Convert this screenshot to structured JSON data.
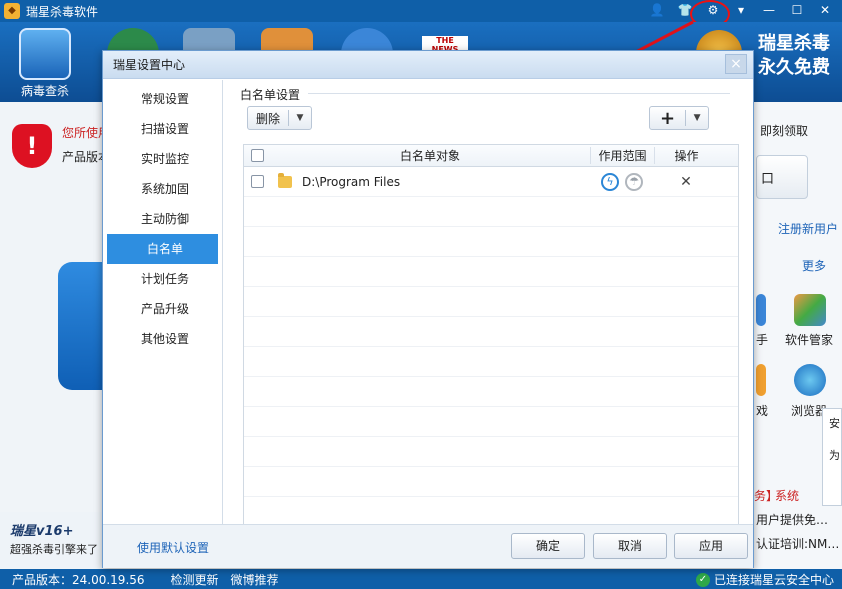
{
  "app": {
    "title": "瑞星杀毒软件",
    "nav": [
      {
        "label": "病毒查杀"
      },
      {
        "label": ""
      },
      {
        "label": ""
      },
      {
        "label": ""
      },
      {
        "label": ""
      },
      {
        "label": "THE NEWS"
      }
    ],
    "brand_line1": "瑞星杀毒",
    "brand_line2": "永久免费",
    "warn_text": "您所使用",
    "product_label": "产品版本",
    "right_links": {
      "receive": "即刻领取",
      "register": "注册新用户",
      "more": "更多",
      "tool_helper": "手",
      "software_mgr": "软件管家",
      "game": "戏",
      "browser": "浏览器",
      "system": "系统",
      "news1": "用户提供免…",
      "news2": "认证培训:NM…",
      "badge_partial": "为",
      "safe_partial": "安",
      "bracket": "务】",
      "button_partial": "口"
    },
    "promo_title": "瑞星v16+",
    "promo_sub": "超强杀毒引擎来了",
    "status": {
      "version": "产品版本：24.00.19.56",
      "check_update": "检测更新",
      "weibo": "微博推荐",
      "cloud": "已连接瑞星云安全中心"
    }
  },
  "dialog": {
    "title": "瑞星设置中心",
    "close": "×",
    "side_items": [
      {
        "label": "常规设置",
        "active": false
      },
      {
        "label": "扫描设置",
        "active": false
      },
      {
        "label": "实时监控",
        "active": false
      },
      {
        "label": "系统加固",
        "active": false
      },
      {
        "label": "主动防御",
        "active": false
      },
      {
        "label": "白名单",
        "active": true
      },
      {
        "label": "计划任务",
        "active": false
      },
      {
        "label": "产品升级",
        "active": false
      },
      {
        "label": "其他设置",
        "active": false
      }
    ],
    "section_title": "白名单设置",
    "delete_label": "删除",
    "add_label": "+",
    "table": {
      "headers": {
        "object": "白名单对象",
        "scope": "作用范围",
        "op": "操作"
      },
      "rows": [
        {
          "path": "D:\\Program Files"
        }
      ]
    },
    "footer": {
      "default_link": "使用默认设置",
      "ok": "确定",
      "cancel": "取消",
      "apply": "应用"
    }
  }
}
